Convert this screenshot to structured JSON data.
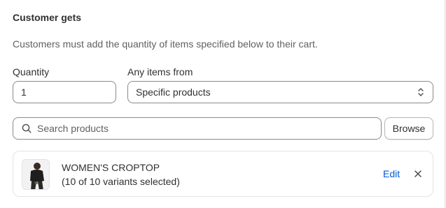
{
  "section": {
    "title": "Customer gets",
    "description": "Customers must add the quantity of items specified below to their cart."
  },
  "quantity": {
    "label": "Quantity",
    "value": "1"
  },
  "any_items": {
    "label": "Any items from",
    "selected": "Specific products"
  },
  "search": {
    "placeholder": "Search products",
    "browse_label": "Browse"
  },
  "product": {
    "name": "WOMEN'S CROPTOP",
    "variants": "(10 of 10 variants selected)",
    "edit_label": "Edit"
  },
  "colors": {
    "link": "#005bd3",
    "border": "#8a8a8a"
  }
}
